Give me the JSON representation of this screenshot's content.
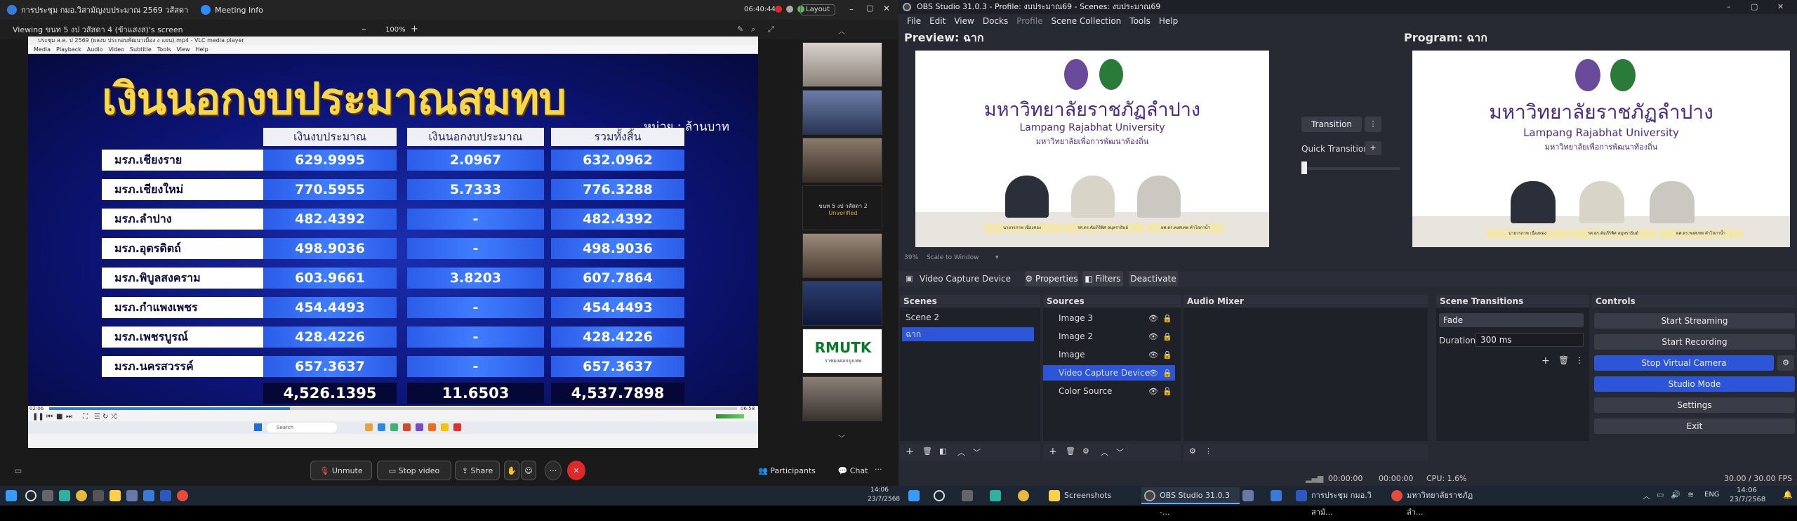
{
  "zoom": {
    "top_tabs": [
      "การประชุม กมอ.วิสามัญงบประมาณ 2569 วสัสดา",
      "Meeting Info"
    ],
    "time": "06:40:44",
    "layout_label": "Layout",
    "viewing_label": "Viewing ขนท 5 งป วสัสดา 4 (ข้าแสงส)'s screen",
    "zoom_level": "100%",
    "zoom_minus": "–",
    "zoom_plus": "+",
    "vlc_title": "ประชุม ส.ค. ป 2569 (ผลงบ ประกอบพัฒนาเมือง ง แผน).mp4 - VLC media player",
    "vlc_menu": [
      "Media",
      "Playback",
      "Audio",
      "Video",
      "Subtitle",
      "Tools",
      "View",
      "Help"
    ],
    "slide": {
      "title": "เงินนอกงบประมาณสมทบ",
      "unit": "หน่วย : ล้านบาท",
      "col_headers": [
        "เงินงบประมาณ",
        "เงินนอกงบประมาณ",
        "รวมทั้งสิ้น"
      ],
      "rows": [
        {
          "name": "มรภ.เชียงราย",
          "v1": "629.9995",
          "v2": "2.0967",
          "v3": "632.0962"
        },
        {
          "name": "มรภ.เชียงใหม่",
          "v1": "770.5955",
          "v2": "5.7333",
          "v3": "776.3288"
        },
        {
          "name": "มรภ.ลำปาง",
          "v1": "482.4392",
          "v2": "-",
          "v3": "482.4392"
        },
        {
          "name": "มรภ.อุตรดิตถ์",
          "v1": "498.9036",
          "v2": "-",
          "v3": "498.9036"
        },
        {
          "name": "มรภ.พิบูลสงคราม",
          "v1": "603.9661",
          "v2": "3.8203",
          "v3": "607.7864"
        },
        {
          "name": "มรภ.กำแพงเพชร",
          "v1": "454.4493",
          "v2": "-",
          "v3": "454.4493"
        },
        {
          "name": "มรภ.เพชรบูรณ์",
          "v1": "428.4226",
          "v2": "-",
          "v3": "428.4226"
        },
        {
          "name": "มรภ.นครสวรรค์",
          "v1": "657.3637",
          "v2": "-",
          "v3": "657.3637"
        }
      ],
      "totals": [
        "4,526.1395",
        "11.6503",
        "4,537.7898"
      ]
    },
    "vlc_time_left": "02:06",
    "vlc_time_right": "06:58",
    "vlc_progress": 0.35,
    "vlc_search": "Search",
    "thumb_tile_name": "ขนท 5 งป วสัสดา 2",
    "thumb_tile_status": "Unverified",
    "thumb_logo": "RMUTK",
    "thumb_logo_sub": "ราชมงคลกรุงเทพ",
    "bottom": {
      "unmute": "Unmute",
      "stop_video": "Stop video",
      "share": "Share",
      "participants": "Participants",
      "chat": "Chat",
      "more": "···"
    },
    "colors": {
      "accent_red": "#e02828",
      "slide_title": "#f6d84a",
      "cell_blue": "#3f7dff"
    }
  },
  "obs": {
    "title": "OBS Studio 31.0.3 - Profile: งบประมาณ69 - Scenes: งบประมาณ69",
    "menu": [
      "File",
      "Edit",
      "View",
      "Docks",
      "Profile",
      "Scene Collection",
      "Tools",
      "Help"
    ],
    "preview_label": "Preview: ฉาก",
    "program_label": "Program: ฉาก",
    "university_th": "มหาวิทยาลัยราชภัฏลำปาง",
    "university_en": "Lampang Rajabhat University",
    "university_sub": "มหาวิทยาลัยเพื่อการพัฒนาท้องถิ่น",
    "nameplates": [
      "นายวรภาพ เนื่องทอง",
      "รศ.ดร.คัมภีร์พิศ สมุทราธิษย์",
      "ผศ.ดร.พงศเทพ คำโสภาน้ำ"
    ],
    "zoom_pct": "39%",
    "scale_label": "Scale to Window",
    "transition_btn": "Transition",
    "quick_transitions": "Quick Transitions",
    "source_bar": {
      "name": "Video Capture Device",
      "properties": "Properties",
      "filters": "Filters",
      "deactivate": "Deactivate"
    },
    "docks": {
      "scenes": "Scenes",
      "sources": "Sources",
      "audio_mixer": "Audio Mixer",
      "scene_transitions": "Scene Transitions",
      "controls": "Controls"
    },
    "scenes": [
      "Scene 2",
      "ฉาก"
    ],
    "sources": [
      "Image 3",
      "Image 2",
      "Image",
      "Video Capture Device",
      "Color Source"
    ],
    "transition_select": "Fade",
    "duration_label": "Duration",
    "duration_value": "300 ms",
    "controls": [
      "Start Streaming",
      "Start Recording",
      "Stop Virtual Camera",
      "Studio Mode",
      "Settings",
      "Exit"
    ],
    "status": {
      "t1": "00:00:00",
      "t2": "00:00:00",
      "cpu": "CPU: 1.6%",
      "fps": "30.00 / 30.00 FPS"
    }
  },
  "taskbar": {
    "search": "Search",
    "screenshots": "Screenshots",
    "obs_item": "OBS Studio 31.0.3 -...",
    "meeting_item": "การประชุม กมอ.วิสามั...",
    "univ_item": "มหาวิทยาลัยราชภัฏลำ...",
    "lang": "ENG",
    "time": "14:06",
    "date": "23/7/2568",
    "time_left": "14:06",
    "date_left": "23/7/2568"
  }
}
